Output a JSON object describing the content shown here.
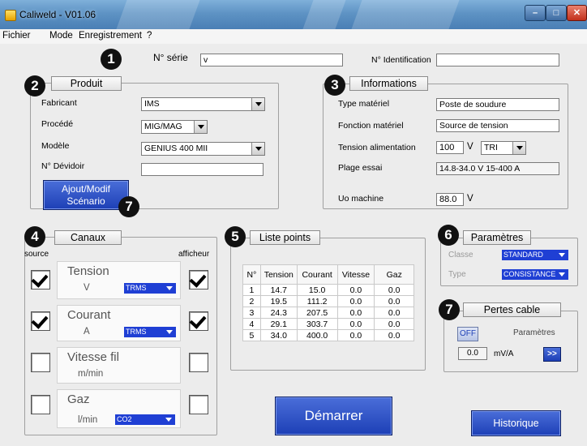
{
  "window": {
    "title": "Caliweld - V01.06"
  },
  "menu": {
    "items": [
      "Fichier",
      "Mode",
      "Enregistrement",
      "?"
    ]
  },
  "badges": [
    "1",
    "2",
    "3",
    "4",
    "5",
    "6",
    "7",
    "7"
  ],
  "header": {
    "serie_label": "N° série",
    "serie_value": "v",
    "identification_label": "N° Identification",
    "identification_value": ""
  },
  "produit": {
    "title": "Produit",
    "fabricant_label": "Fabricant",
    "fabricant_value": "IMS",
    "procede_label": "Procédé",
    "procede_value": "MIG/MAG",
    "modele_label": "Modèle",
    "modele_value": "GENIUS 400 MII",
    "devidoir_label": "N° Dévidoir",
    "devidoir_value": "",
    "scenario_line1": "Ajout/Modif",
    "scenario_line2": "Scénario"
  },
  "informations": {
    "title": "Informations",
    "type_label": "Type matériel",
    "type_value": "Poste de soudure",
    "fonction_label": "Fonction matériel",
    "fonction_value": "Source de tension",
    "tension_label": "Tension alimentation",
    "tension_value": "100",
    "tension_unit": "V",
    "tension_phase": "TRI",
    "plage_label": "Plage essai",
    "plage_value": "14.8-34.0 V  15-400 A",
    "uo_label": "Uo machine",
    "uo_value": "88.0",
    "uo_unit": "V"
  },
  "canaux": {
    "title": "Canaux",
    "source_label": "source",
    "afficheur_label": "afficheur",
    "channels": [
      {
        "name": "Tension",
        "unit": "V",
        "mode": "TRMS",
        "source_checked": true,
        "afficheur_checked": true
      },
      {
        "name": "Courant",
        "unit": "A",
        "mode": "TRMS",
        "source_checked": true,
        "afficheur_checked": true
      },
      {
        "name": "Vitesse fil",
        "unit": "m/min",
        "mode": "",
        "source_checked": false,
        "afficheur_checked": false
      },
      {
        "name": "Gaz",
        "unit": "l/min",
        "mode": "CO2",
        "source_checked": false,
        "afficheur_checked": false
      }
    ]
  },
  "liste_points": {
    "title": "Liste points",
    "columns": [
      "N°",
      "Tension",
      "Courant",
      "Vitesse",
      "Gaz"
    ],
    "rows": [
      [
        "1",
        "14.7",
        "15.0",
        "0.0",
        "0.0"
      ],
      [
        "2",
        "19.5",
        "111.2",
        "0.0",
        "0.0"
      ],
      [
        "3",
        "24.3",
        "207.5",
        "0.0",
        "0.0"
      ],
      [
        "4",
        "29.1",
        "303.7",
        "0.0",
        "0.0"
      ],
      [
        "5",
        "34.0",
        "400.0",
        "0.0",
        "0.0"
      ]
    ]
  },
  "parametres": {
    "title": "Paramètres",
    "classe_label": "Classe",
    "classe_value": "STANDARD",
    "type_label": "Type",
    "type_value": "CONSISTANCE"
  },
  "pertes": {
    "title": "Pertes cable",
    "toggle_label": "OFF",
    "parametres_label": "Paramètres",
    "value": "0.0",
    "unit": "mV/A",
    "more_label": ">>"
  },
  "actions": {
    "start_label": "Démarrer",
    "history_label": "Historique"
  }
}
